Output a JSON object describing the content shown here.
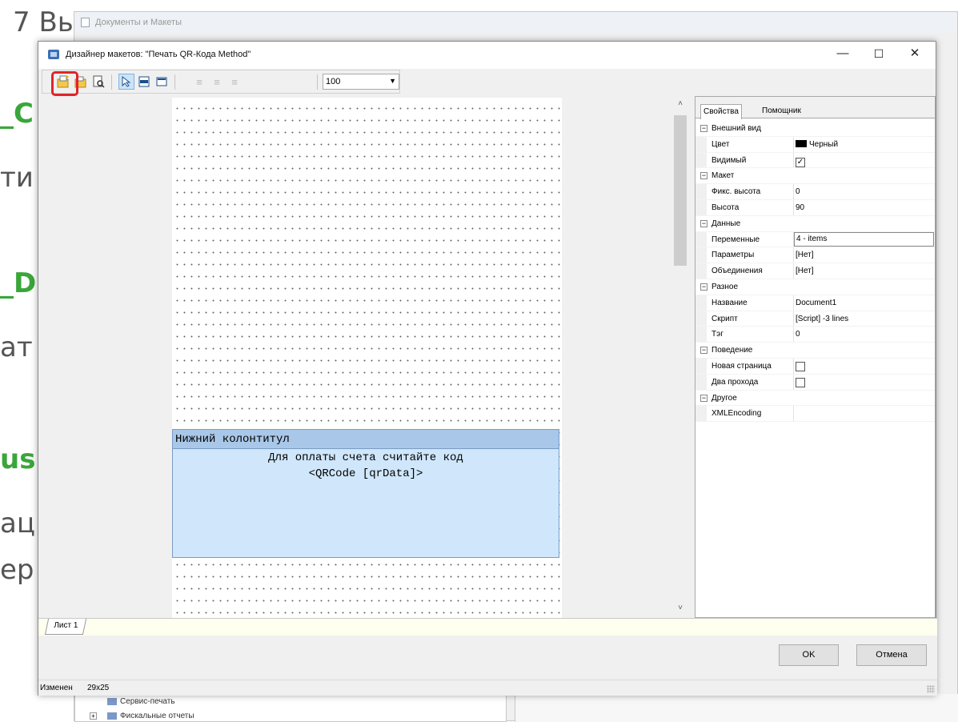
{
  "background": {
    "fragments": [
      "7 Вы",
      "_C",
      "ти",
      "_D",
      "ат",
      "us",
      "ац",
      "ер"
    ],
    "back_window_title": "Документы и Макеты",
    "tree_items": [
      "Сервис-печать",
      "Фискальные отчеты"
    ]
  },
  "window": {
    "title": "Дизайнер макетов: \"Печать QR-Кода Method\"",
    "minimize": "—",
    "maximize": "☐",
    "close": "✕"
  },
  "toolbar": {
    "zoom_value": "100"
  },
  "designer": {
    "band_title": "Нижний колонтитул",
    "line1": "Для оплаты счета считайте код",
    "line2": "<QRCode [qrData]>"
  },
  "sheet_tab": "Лист 1",
  "properties": {
    "tabs": [
      "Свойства",
      "Помощник"
    ],
    "categories": {
      "appearance": "Внешний вид",
      "layout": "Макет",
      "data": "Данные",
      "misc": "Разное",
      "behavior": "Поведение",
      "other": "Другое"
    },
    "rows": {
      "color": {
        "name": "Цвет",
        "value": "Черный"
      },
      "visible": {
        "name": "Видимый",
        "value": "✓"
      },
      "fixed_height": {
        "name": "Фикс. высота",
        "value": "0"
      },
      "height": {
        "name": "Высота",
        "value": "90"
      },
      "variables": {
        "name": "Переменные",
        "value": "4 - items"
      },
      "parameters": {
        "name": "Параметры",
        "value": "[Нет]"
      },
      "joins": {
        "name": "Объединения",
        "value": "[Нет]"
      },
      "name": {
        "name": "Название",
        "value": "Document1"
      },
      "script": {
        "name": "Скрипт",
        "value": "[Script] -3 lines"
      },
      "tag": {
        "name": "Тэг",
        "value": "0"
      },
      "new_page": {
        "name": "Новая страница",
        "value": ""
      },
      "two_pass": {
        "name": "Два прохода",
        "value": ""
      },
      "xml_encoding": {
        "name": "XMLEncoding",
        "value": ""
      }
    },
    "color_swatch": "#000000"
  },
  "buttons": {
    "ok": "OK",
    "cancel": "Отмена"
  },
  "status": {
    "state": "Изменен",
    "size": "29x25"
  },
  "colors": {
    "highlight": "#e0242b",
    "band_header": "#a9c7e8",
    "band_body": "#cfe6fb"
  }
}
